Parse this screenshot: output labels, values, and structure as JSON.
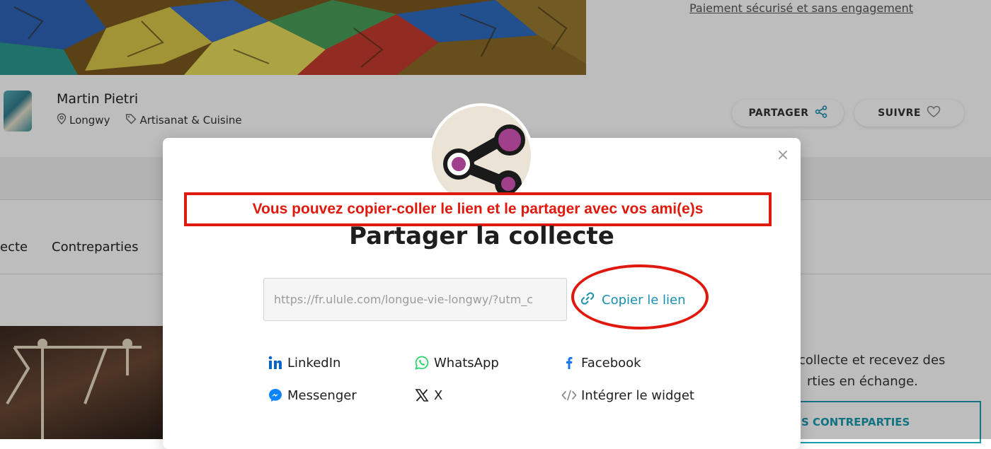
{
  "page": {
    "secure_payment_text": "Paiement sécurisé et sans engagement",
    "owner": {
      "name": "Martin Pietri",
      "location": "Longwy",
      "category": "Artisanat & Cuisine"
    },
    "actions": {
      "share_label": "PARTAGER",
      "follow_label": "SUIVRE"
    },
    "tabs": [
      "ecte",
      "Contreparties"
    ],
    "side_text_line1": "collecte et recevez des",
    "side_text_line2": "rties en échange.",
    "cta_label": "S CONTREPARTIES"
  },
  "modal": {
    "annotation": "Vous pouvez copier-coller le lien et le partager avec vos ami(e)s",
    "title": "Partager la collecte",
    "url_value": "https://fr.ulule.com/longue-vie-longwy/?utm_c",
    "copy_label": "Copier le lien",
    "close_symbol": "×",
    "share_options": [
      {
        "label": "LinkedIn",
        "icon": "linkedin-icon"
      },
      {
        "label": "WhatsApp",
        "icon": "whatsapp-icon"
      },
      {
        "label": "Facebook",
        "icon": "facebook-icon"
      },
      {
        "label": "Messenger",
        "icon": "messenger-icon"
      },
      {
        "label": "X",
        "icon": "x-icon"
      },
      {
        "label": "Intégrer le widget",
        "icon": "code-icon"
      }
    ]
  },
  "colors": {
    "accent": "#1b8fb0",
    "annotation_red": "#e0190e",
    "logo_purple": "#a0408a"
  }
}
